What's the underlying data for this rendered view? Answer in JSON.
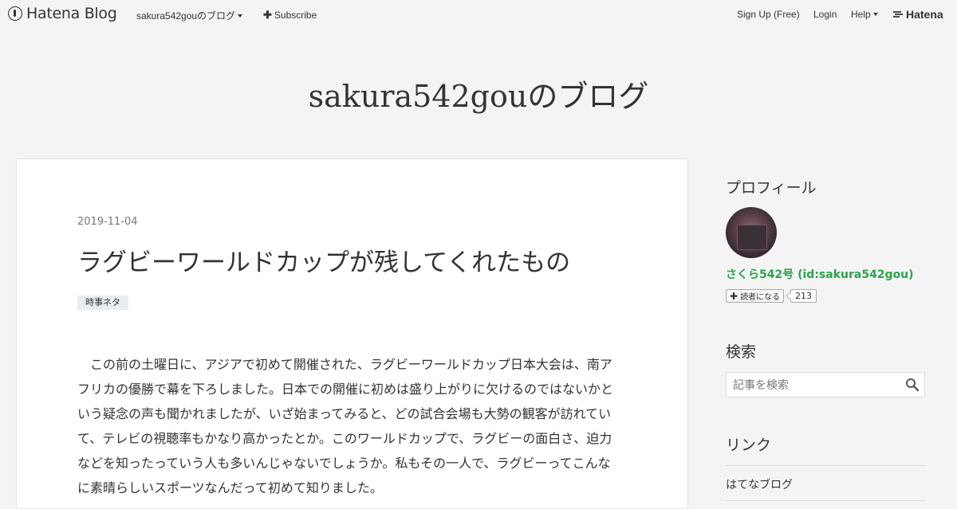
{
  "topbar": {
    "brand": "Hatena Blog",
    "blog_menu": "sakura542gouのブログ",
    "subscribe": "Subscribe",
    "signup": "Sign Up (Free)",
    "login": "Login",
    "help": "Help",
    "hatena": "Hatena"
  },
  "blog": {
    "title": "sakura542gouのブログ"
  },
  "entry": {
    "date": "2019-11-04",
    "title": "ラグビーワールドカップが残してくれたもの",
    "category": "時事ネタ",
    "body": "　この前の土曜日に、アジアで初めて開催された、ラグビーワールドカップ日本大会は、南アフリカの優勝で幕を下ろしました。日本での開催に初めは盛り上がりに欠けるのではないかという疑念の声も聞かれましたが、いざ始まってみると、どの試合会場も大勢の観客が訪れていて、テレビの視聴率もかなり高かったとか。このワールドカップで、ラグビーの面白さ、迫力などを知ったっていう人も多いんじゃないでしょうか。私もその一人で、ラグビーってこんなに素晴らしいスポーツなんだって初めて知りました。"
  },
  "sidebar": {
    "profile_heading": "プロフィール",
    "profile_name": "さくら542号 (id:sakura542gou)",
    "follow_label": "読者になる",
    "follow_count": "213",
    "search_heading": "検索",
    "search_placeholder": "記事を検索",
    "links_heading": "リンク",
    "links": [
      "はてなブログ"
    ]
  },
  "colors": {
    "accent_green": "#2da24b",
    "background": "#f4f4f4"
  },
  "icons": {
    "search": "search-icon",
    "brand": "hatena-blog-icon",
    "plus": "plus-icon"
  }
}
